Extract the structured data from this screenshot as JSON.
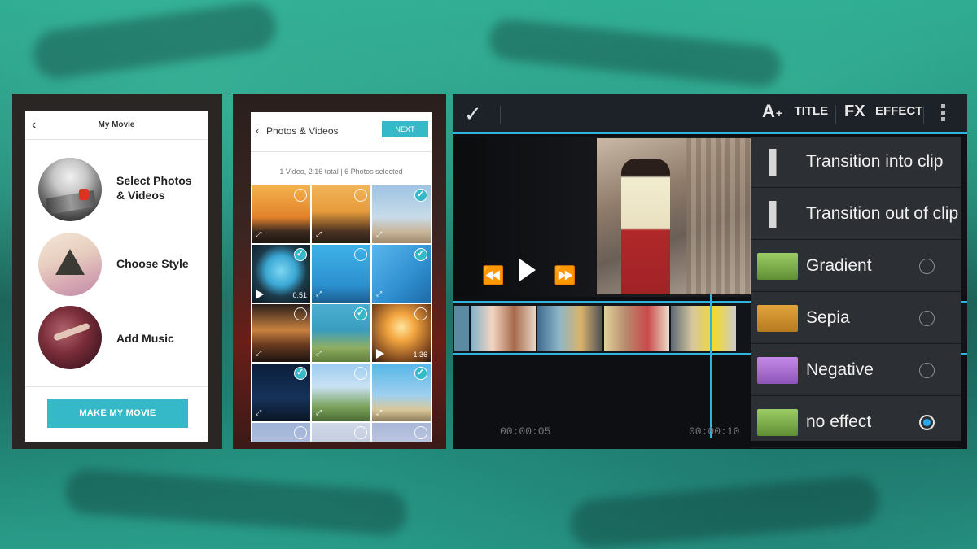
{
  "left_screen": {
    "header_title": "My Movie",
    "items": [
      {
        "label_line1": "Select Photos",
        "label_line2": "& Videos"
      },
      {
        "label_line1": "Choose Style",
        "label_line2": ""
      },
      {
        "label_line1": "Add Music",
        "label_line2": ""
      }
    ],
    "make_button": "MAKE MY MOVIE"
  },
  "middle_screen": {
    "header_title": "Photos & Videos",
    "next_button": "NEXT",
    "summary": "1 Video, 2:16 total | 6 Photos selected",
    "thumbnails": [
      {
        "selected": false,
        "duration": ""
      },
      {
        "selected": false,
        "duration": ""
      },
      {
        "selected": true,
        "duration": ""
      },
      {
        "selected": true,
        "duration": "0:51"
      },
      {
        "selected": false,
        "duration": ""
      },
      {
        "selected": true,
        "duration": ""
      },
      {
        "selected": false,
        "duration": ""
      },
      {
        "selected": true,
        "duration": ""
      },
      {
        "selected": false,
        "duration": "1:36"
      },
      {
        "selected": true,
        "duration": ""
      },
      {
        "selected": false,
        "duration": ""
      },
      {
        "selected": true,
        "duration": ""
      },
      {
        "selected": false,
        "duration": ""
      },
      {
        "selected": false,
        "duration": ""
      },
      {
        "selected": false,
        "duration": ""
      }
    ]
  },
  "right_screen": {
    "toolbar": {
      "title_icon": "A",
      "title_label": "TITLE",
      "effect_icon": "FX",
      "effect_label": "EFFECT"
    },
    "timecodes": [
      "00:00:05",
      "00:00:10"
    ],
    "menu": [
      {
        "label": "Transition into clip",
        "icon": "transition-in-icon",
        "radio": false
      },
      {
        "label": "Transition out of clip",
        "icon": "transition-out-icon",
        "radio": false
      },
      {
        "label": "Gradient",
        "icon": "android-green-icon",
        "radio": true,
        "checked": false
      },
      {
        "label": "Sepia",
        "icon": "android-sepia-icon",
        "radio": true,
        "checked": false
      },
      {
        "label": "Negative",
        "icon": "android-negative-icon",
        "radio": true,
        "checked": false
      },
      {
        "label": "no effect",
        "icon": "android-green-icon",
        "radio": true,
        "checked": true
      }
    ]
  },
  "colors": {
    "accent_teal": "#35b8c7",
    "accent_blue": "#2fb5e0",
    "radio_blue": "#2aa9ea"
  }
}
